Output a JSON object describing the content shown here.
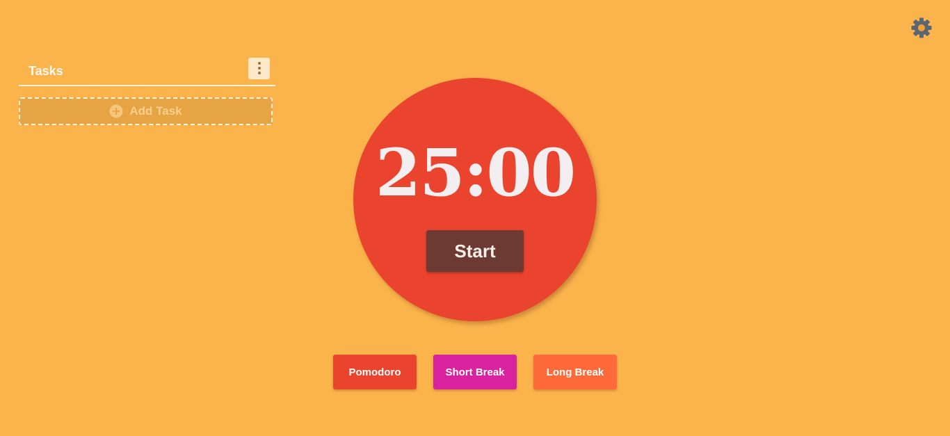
{
  "header": {
    "settings_icon": "gear-icon"
  },
  "tasks": {
    "title": "Tasks",
    "menu_icon": "more-vertical-icon",
    "add_task_label": "Add Task",
    "add_task_icon": "plus-circle-icon"
  },
  "timer": {
    "display": "25:00",
    "start_label": "Start"
  },
  "modes": [
    {
      "label": "Pomodoro",
      "color": "#ea432e"
    },
    {
      "label": "Short Break",
      "color": "#d9239e"
    },
    {
      "label": "Long Break",
      "color": "#ff6a3a"
    }
  ],
  "colors": {
    "background": "#fbb34b",
    "timer_circle": "#ea432e",
    "start_button": "#6c3a33",
    "gear": "#5a6673"
  }
}
